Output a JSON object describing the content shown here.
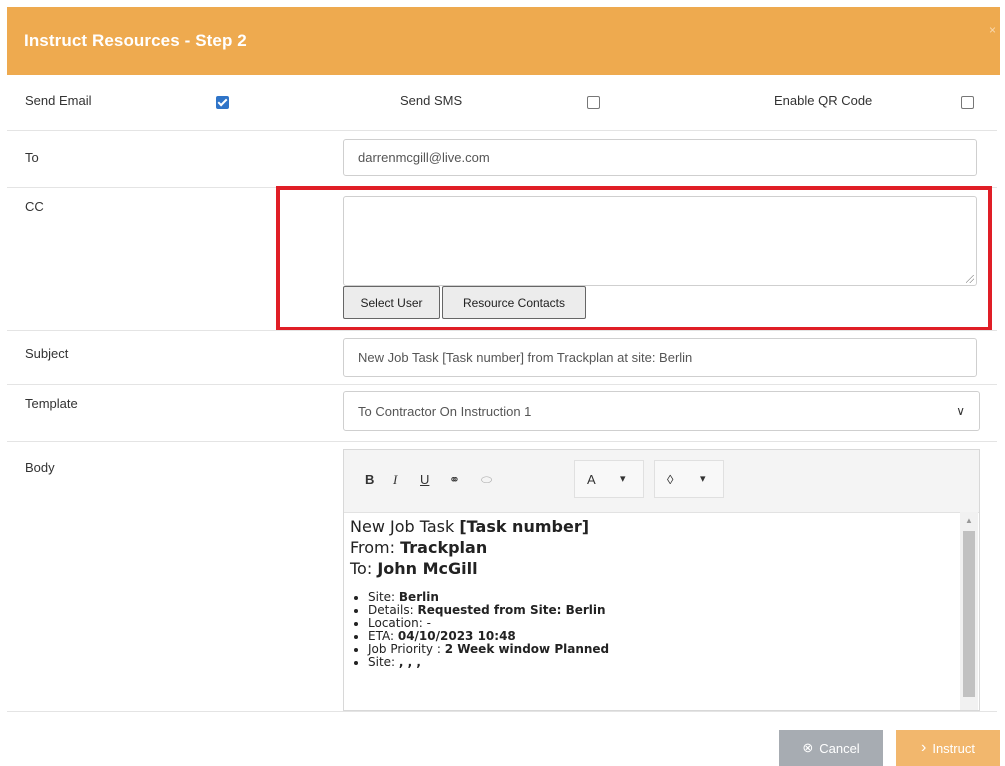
{
  "dialog": {
    "title": "Instruct Resources - Step 2",
    "close_symbol": "×"
  },
  "options": {
    "send_email": {
      "label": "Send Email",
      "checked": true
    },
    "send_sms": {
      "label": "Send SMS",
      "checked": false
    },
    "enable_qr": {
      "label": "Enable QR Code",
      "checked": false
    }
  },
  "to": {
    "label": "To",
    "value": "darrenmcgill@live.com"
  },
  "cc": {
    "label": "CC",
    "value": "",
    "select_user": "Select User",
    "resource_contacts": "Resource Contacts"
  },
  "subject": {
    "label": "Subject",
    "value": "New Job Task [Task number] from Trackplan at site: Berlin"
  },
  "template": {
    "label": "Template",
    "value": "To Contractor On Instruction 1"
  },
  "body": {
    "label": "Body",
    "toolbar": {
      "bold": "B",
      "italic": "I",
      "underline": "U",
      "link": "⚭",
      "unlink": "⬭",
      "font_color": "A",
      "fill": "◊",
      "caret": "▾"
    },
    "line1_prefix": "New Job Task ",
    "line1_bold": "[Task number]",
    "line2_prefix": "From: ",
    "line2_bold": "Trackplan",
    "line3_prefix": "To: ",
    "line3_bold": "John McGill",
    "items": [
      {
        "label": "Site: ",
        "value": "Berlin"
      },
      {
        "label": "Details: ",
        "value": "Requested from Site: Berlin"
      },
      {
        "label": "Location: -",
        "value": ""
      },
      {
        "label": "ETA: ",
        "value": "04/10/2023 10:48"
      },
      {
        "label": "Job Priority : ",
        "value": "2 Week window Planned"
      },
      {
        "label": "Site: ",
        "value": ", , ,"
      }
    ]
  },
  "footer": {
    "cancel_label": "Cancel",
    "cancel_icon": "⊗",
    "instruct_label": "Instruct",
    "instruct_icon": "›"
  },
  "colors": {
    "header": "#eeaa4f",
    "highlight": "#e01e26",
    "cancel": "#a7acb2",
    "instruct": "#f2b76d"
  }
}
